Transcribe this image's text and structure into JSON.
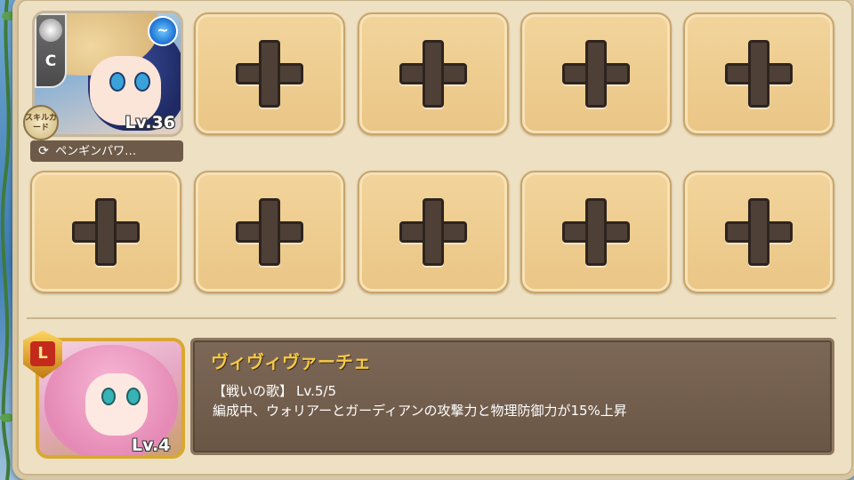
{
  "party_slots": {
    "filled": {
      "rarity": "C",
      "level": "Lv.36",
      "skill_card_badge": "スキルカード",
      "skill_name": "ペンギンパワ…",
      "element_icon": "water-icon"
    },
    "empty_slot_icon": "plus-icon",
    "empty_count": 9
  },
  "leader": {
    "rarity": "L",
    "level": "Lv.4",
    "name": "ヴィヴィヴァーチェ",
    "skill_title": "【戦いの歌】",
    "skill_level": "Lv.5/5",
    "skill_description": "編成中、ウォリアーとガーディアンの攻撃力と物理防御力が15%上昇"
  },
  "colors": {
    "slot_fill": "#eac686",
    "plus": "#4e4037",
    "panel": "#6a5645",
    "name_gold": "#f5c945"
  }
}
